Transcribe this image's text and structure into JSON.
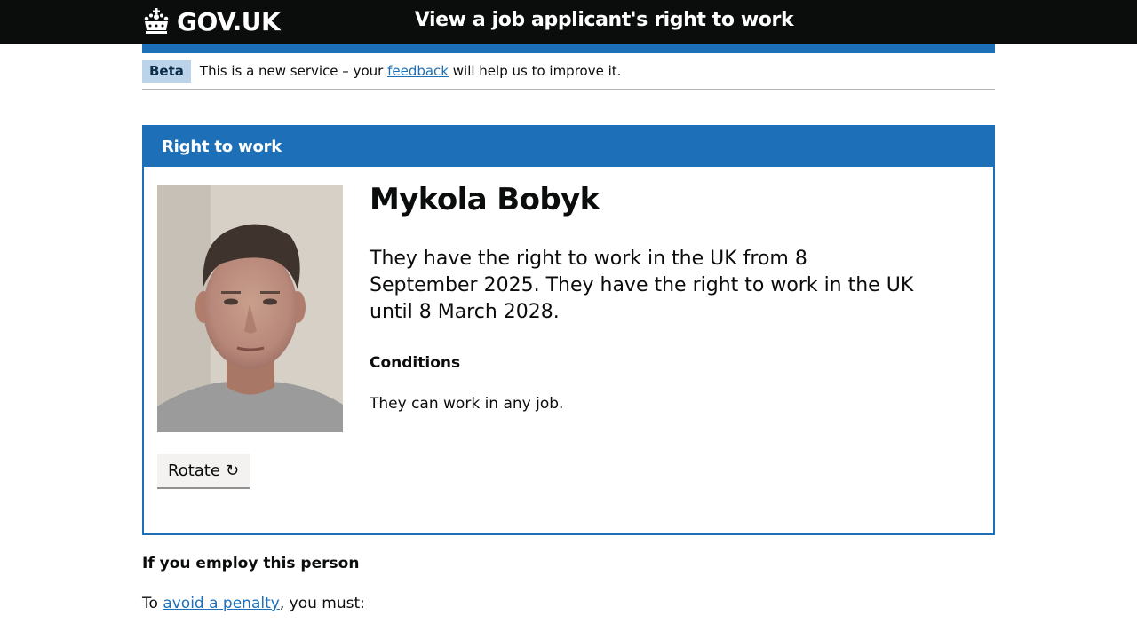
{
  "header": {
    "logo_text": "GOV.UK",
    "service_name": "View a job applicant's right to work",
    "logo_icon": "crown-icon"
  },
  "phase_banner": {
    "tag": "Beta",
    "text_before": "This is a new service – your ",
    "link": "feedback",
    "text_after": " will help us to improve it."
  },
  "panel": {
    "heading": "Right to work",
    "person_name": "Mykola Bobyk",
    "right_to_work": "They have the right to work in the UK from 8 September 2025. They have the right to work in the UK until 8 March 2028.",
    "conditions_heading": "Conditions",
    "conditions_text": "They can work in any job.",
    "rotate_label": "Rotate",
    "rotate_icon_glyph": "↻"
  },
  "employ": {
    "heading": "If you employ this person",
    "text_before": "To ",
    "link": "avoid a penalty",
    "text_after": ", you must:"
  },
  "colors": {
    "header_bg": "#0b0c0c",
    "brand_blue": "#1d70b8",
    "beta_tag_bg": "#bbd4ea",
    "button_bg": "#f3f2f1"
  }
}
